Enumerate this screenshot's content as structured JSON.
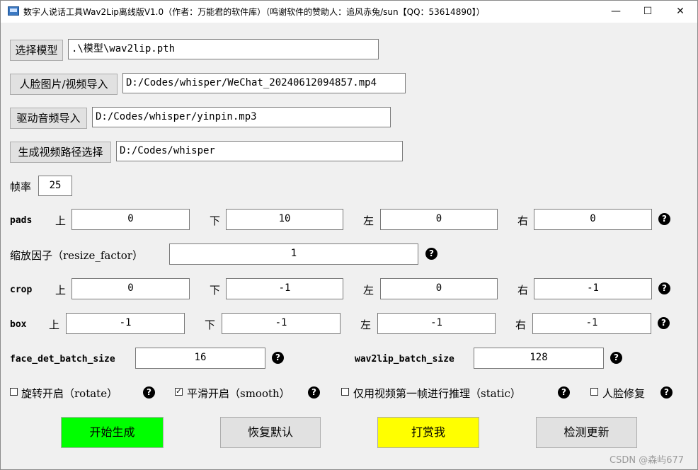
{
  "window": {
    "title": "数字人说话工具Wav2Lip离线版V1.0（作者：万能君的软件库）（鸣谢软件的赞助人：追风赤兔/sun【QQ：53614890】）",
    "minimize": "—",
    "maximize": "☐",
    "close": "✕"
  },
  "files": {
    "model": {
      "button": "选择模型",
      "value": ".\\模型\\wav2lip.pth"
    },
    "face": {
      "button": "人脸图片/视频导入",
      "value": "D:/Codes/whisper/WeChat_20240612094857.mp4"
    },
    "audio": {
      "button": "驱动音频导入",
      "value": "D:/Codes/whisper/yinpin.mp3"
    },
    "output": {
      "button": "生成视频路径选择",
      "value": "D:/Codes/whisper"
    }
  },
  "fps": {
    "label": "帧率",
    "value": "25"
  },
  "pads": {
    "label": "pads",
    "top_label": "上",
    "top": "0",
    "bottom_label": "下",
    "bottom": "10",
    "left_label": "左",
    "left": "0",
    "right_label": "右",
    "right": "0"
  },
  "resize": {
    "label": "缩放因子（resize_factor）",
    "value": "1"
  },
  "crop": {
    "label": "crop",
    "top_label": "上",
    "top": "0",
    "bottom_label": "下",
    "bottom": "-1",
    "left_label": "左",
    "left": "0",
    "right_label": "右",
    "right": "-1"
  },
  "box": {
    "label": "box",
    "top_label": "上",
    "top": "-1",
    "bottom_label": "下",
    "bottom": "-1",
    "left_label": "左",
    "left": "-1",
    "right_label": "右",
    "right": "-1"
  },
  "batch": {
    "face_label": "face_det_batch_size",
    "face_value": "16",
    "wav_label": "wav2lip_batch_size",
    "wav_value": "128"
  },
  "options": {
    "rotate": {
      "label": "旋转开启（rotate）",
      "checked": false
    },
    "smooth": {
      "label": "平滑开启（smooth）",
      "checked": true,
      "mark": "✓"
    },
    "static": {
      "label": "仅用视频第一帧进行推理（static）",
      "checked": false
    },
    "restore": {
      "label": "人脸修复",
      "checked": false
    }
  },
  "help_glyph": "?",
  "actions": {
    "start": "开始生成",
    "reset": "恢复默认",
    "tip": "打赏我",
    "update": "检测更新"
  },
  "colors": {
    "start_bg": "#00ff00",
    "tip_bg": "#ffff00",
    "default_bg": "#e1e1e1"
  },
  "watermark": "CSDN @森屿677"
}
